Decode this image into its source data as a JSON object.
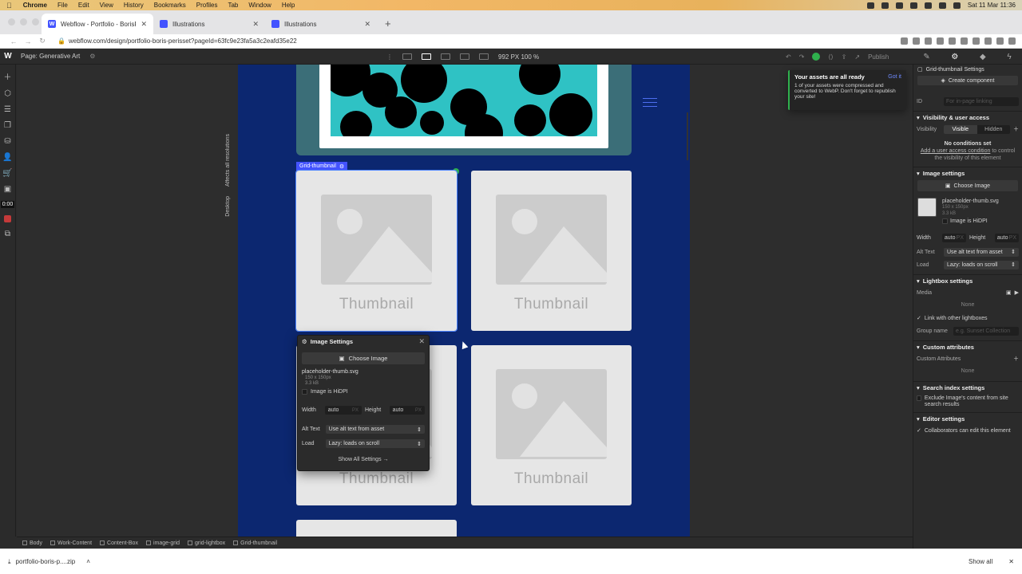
{
  "menubar": {
    "app": "Chrome",
    "items": [
      "File",
      "Edit",
      "View",
      "History",
      "Bookmarks",
      "Profiles",
      "Tab",
      "Window",
      "Help"
    ],
    "clock": "Sat 11 Mar  11:36"
  },
  "tabs": [
    {
      "title": "Webflow - Portfolio - BorisPérisset"
    },
    {
      "title": "Illustrations"
    },
    {
      "title": "Illustrations"
    }
  ],
  "address": {
    "url": "webflow.com/design/portfolio-boris-perisset?pageId=63fc9e23fa5a3c2eafd35e22"
  },
  "webflow": {
    "logo": "W",
    "page_label": "Page: Generative Art",
    "viewport": "992 PX  100 %",
    "publish": "Publish",
    "timer": "0:00"
  },
  "canvas": {
    "side_tag_1": "Affects all resolutions",
    "side_tag_2": "Desktop",
    "grid_tag": "Grid-thumbnail",
    "thumbnail_text": "Thumbnail"
  },
  "popover": {
    "title": "Image Settings",
    "choose": "Choose Image",
    "filename": "placeholder-thumb.svg",
    "dims": "150 x 150px",
    "size": "3.3 kB",
    "hidpi": "Image is HiDPI",
    "width_label": "Width",
    "width_value": "auto",
    "height_label": "Height",
    "height_value": "auto",
    "unit": "PX",
    "alt_label": "Alt Text",
    "alt_value": "Use alt text from asset",
    "load_label": "Load",
    "load_value": "Lazy: loads on scroll",
    "show_all": "Show All Settings →"
  },
  "toast": {
    "title": "Your assets are all ready",
    "got_it": "Got it",
    "body": "1 of your assets were compressed and converted to WebP. Don't forget to republish your site!"
  },
  "panel": {
    "title": "Grid-thumbnail Settings",
    "create_component": "Create component",
    "id_label": "ID",
    "id_placeholder": "For in-page linking",
    "visibility_section": "Visibility & user access",
    "visibility_label": "Visibility",
    "visible": "Visible",
    "hidden": "Hidden",
    "no_conditions": "No conditions set",
    "user_access_link": "Add a user access condition",
    "user_access_rest": " to control the visibility of this element",
    "image_section": "Image settings",
    "choose_image": "Choose Image",
    "filename": "placeholder-thumb.svg",
    "dims": "150 x 150px",
    "size": "3.3 kB",
    "hidpi": "Image is HiDPI",
    "width_label": "Width",
    "width_value": "auto",
    "height_label": "Height",
    "height_value": "auto",
    "unit": "PX",
    "alt_label": "Alt Text",
    "alt_value": "Use alt text from asset",
    "load_label": "Load",
    "load_value": "Lazy: loads on scroll",
    "lightbox_section": "Lightbox settings",
    "media_label": "Media",
    "none": "None",
    "link_lightboxes": "Link with other lightboxes",
    "group_label": "Group name",
    "group_placeholder": "e.g. Sunset Collection",
    "custom_attr_section": "Custom attributes",
    "custom_attr_label": "Custom Attributes",
    "search_section": "Search index settings",
    "exclude": "Exclude Image's content from site search results",
    "editor_section": "Editor settings",
    "collaborators": "Collaborators can edit this element"
  },
  "breadcrumbs": [
    "Body",
    "Work-Content",
    "Content-Box",
    "image-grid",
    "grid-lightbox",
    "Grid-thumbnail"
  ],
  "download": {
    "file": "portfolio-boris-p....zip",
    "show_all": "Show all"
  },
  "colors": {
    "page_bg": "#0c2770",
    "accent": "#4353ff",
    "success": "#2fb14d"
  }
}
